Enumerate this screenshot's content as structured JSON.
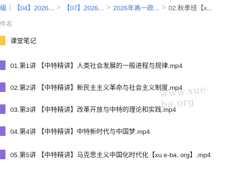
{
  "breadcrumb": {
    "items": [
      "级",
      "【04】2026...",
      "【07】2026...",
      "2026年高一政...",
      "02.秋季班【x..."
    ],
    "separators": [
      "|",
      ">",
      ">",
      ">",
      ">"
    ]
  },
  "columns": {
    "name_header": "件名"
  },
  "files": [
    {
      "name": "课堂笔记",
      "icon": "folder-icon",
      "color": "#f5c84c"
    },
    {
      "name": "01.第1讲 【中特精讲】人类社会发展的一般进程与规律.mp4",
      "icon": "video-file-icon",
      "color": "#8a6cd6"
    },
    {
      "name": "02.第2讲 【中特精讲】新民主主义革命与社会主义制度.mp4",
      "icon": "video-file-icon",
      "color": "#8a6cd6"
    },
    {
      "name": "03.第3讲 【中特精讲】改革开放与中特的理论和实践.mp4",
      "icon": "video-file-icon",
      "color": "#8a6cd6"
    },
    {
      "name": "04.第4讲 【中特精讲】中特新时代与中国梦.mp4",
      "icon": "video-file-icon",
      "color": "#8a6cd6"
    },
    {
      "name": "05.第5讲 【中特精讲】马克思主义中国化时代化【xu e-ba. org】.mp4",
      "icon": "video-file-icon",
      "color": "#8a6cd6"
    }
  ],
  "watermark": "www.xue-ba.org"
}
